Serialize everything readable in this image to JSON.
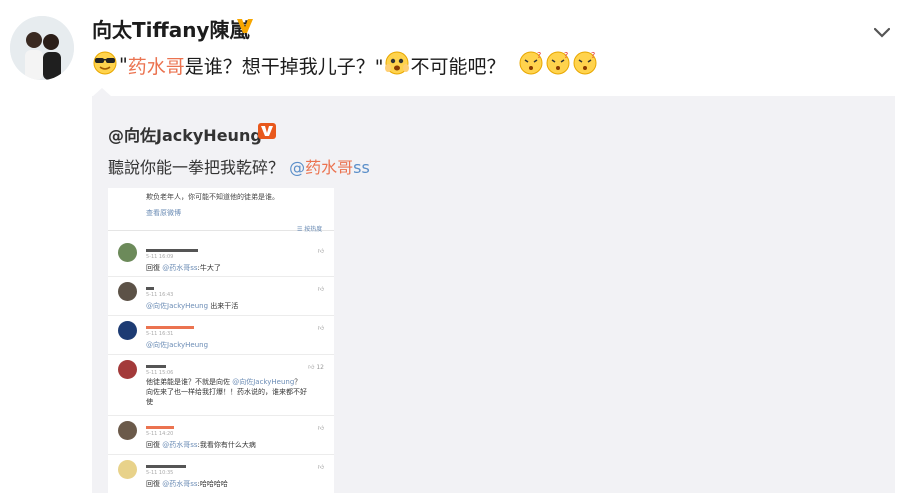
{
  "post": {
    "username": "向太Tiffany陳嵐",
    "text_pre": "\"",
    "text_quoted": "药水哥",
    "text_mid": "是谁？想干掉我儿子？\"",
    "text_after": "不可能吧？"
  },
  "icons": {
    "verified": "verified-v-badge",
    "menu": "chevron-down-icon",
    "emojis": [
      "cool-sunglasses-emoji",
      "scared-emoji",
      "puzzled-emoji",
      "puzzled-emoji",
      "puzzled-emoji"
    ]
  },
  "colors": {
    "accent": "#eb7350",
    "link": "#5b8fc9",
    "badge": "#f7a600",
    "repost_bg": "#f2f2f5"
  },
  "repost": {
    "username": "@向佐JackyHeung",
    "text": "聽說你能一拳把我乾碎？",
    "mention_at": "@",
    "mention_name": "药水哥",
    "mention_tail": "ss"
  },
  "screenshot": {
    "header_text": "欺负老年人，你可能不知道他的徒弟是谁。",
    "view_source": "查看原微博",
    "sort_label": "按热度",
    "comments": [
      {
        "time": "5-11 16:09",
        "body_pre": "回復 ",
        "body_mention": "@药水哥ss",
        "body_post": ":牛大了",
        "likes": ""
      },
      {
        "time": "5-11 16:43",
        "body_pre": "",
        "body_mention": "@向佐JackyHeung",
        "body_post": " 出来干活",
        "likes": ""
      },
      {
        "time": "5-11 16:31",
        "body_pre": "",
        "body_mention": "@向佐JackyHeung",
        "body_post": "",
        "likes": ""
      },
      {
        "time": "5-11 15:06",
        "body_pre": "他徒弟能是谁？不就是向佐 ",
        "body_mention": "@向佐JackyHeung",
        "body_post": "？",
        "body2": "向佐来了也一样给我打爆！！药水说的，谁来都不好",
        "body3": "使",
        "likes": "12"
      },
      {
        "time": "5-11 14:20",
        "body_pre": "回復 ",
        "body_mention": "@药水哥ss",
        "body_post": ":我看你有什么大病",
        "likes": ""
      },
      {
        "time": "5-11 10:35",
        "body_pre": "回復 ",
        "body_mention": "@药水哥ss",
        "body_post": ":哈哈哈哈",
        "likes": ""
      }
    ]
  }
}
